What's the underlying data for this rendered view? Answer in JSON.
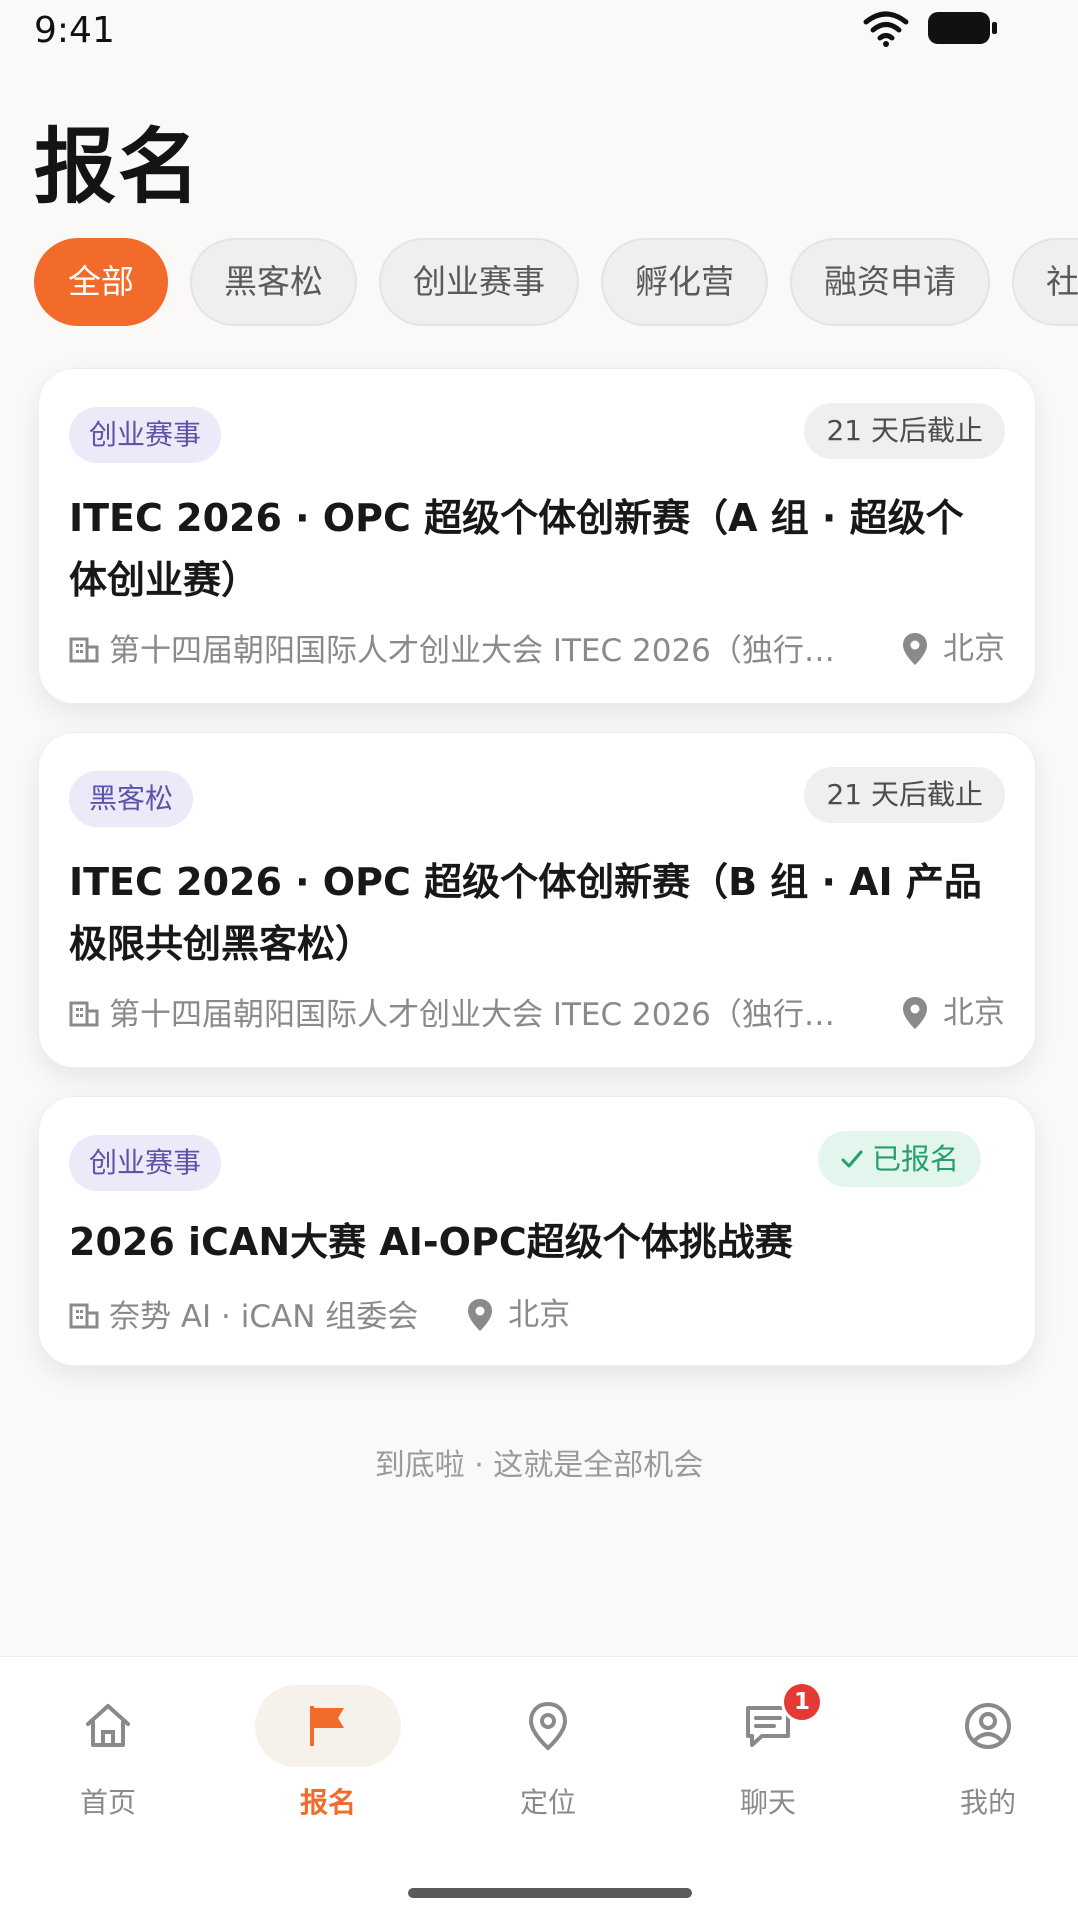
{
  "status_bar": {
    "time": "9:41"
  },
  "page": {
    "title": "报名"
  },
  "filters": [
    "全部",
    "黑客松",
    "创业赛事",
    "孵化营",
    "融资申请",
    "社区活动"
  ],
  "active_filter": "全部",
  "cards": [
    {
      "tag": "创业赛事",
      "deadline": "21 天后截止",
      "title": "ITEC 2026 · OPC 超级个体创新赛（A 组 · 超级个体创业赛）",
      "org": "第十四届朝阳国际人才创业大会 ITEC 2026（独行…",
      "location": "北京"
    },
    {
      "tag": "黑客松",
      "deadline": "21 天后截止",
      "title": "ITEC 2026 · OPC 超级个体创新赛（B 组 · AI 产品极限共创黑客松）",
      "org": "第十四届朝阳国际人才创业大会 ITEC 2026（独行…",
      "location": "北京"
    },
    {
      "tag": "创业赛事",
      "status": "已报名",
      "title": "2026 iCAN大赛 AI-OPC超级个体挑战赛",
      "org": "奈势 AI · iCAN 组委会",
      "location": "北京"
    }
  ],
  "end_text": "到底啦 · 这就是全部机会",
  "nav": {
    "items": [
      {
        "label": "首页",
        "icon": "home-icon"
      },
      {
        "label": "报名",
        "icon": "flag-icon"
      },
      {
        "label": "定位",
        "icon": "location-pin-icon"
      },
      {
        "label": "聊天",
        "icon": "chat-icon",
        "badge": "1"
      },
      {
        "label": "我的",
        "icon": "profile-icon"
      }
    ],
    "active": "报名"
  },
  "colors": {
    "accent": "#f26b2a",
    "tag_bg": "#eceaf8",
    "tag_text": "#5c54a6",
    "success": "#23a06b",
    "badge": "#e53935"
  }
}
